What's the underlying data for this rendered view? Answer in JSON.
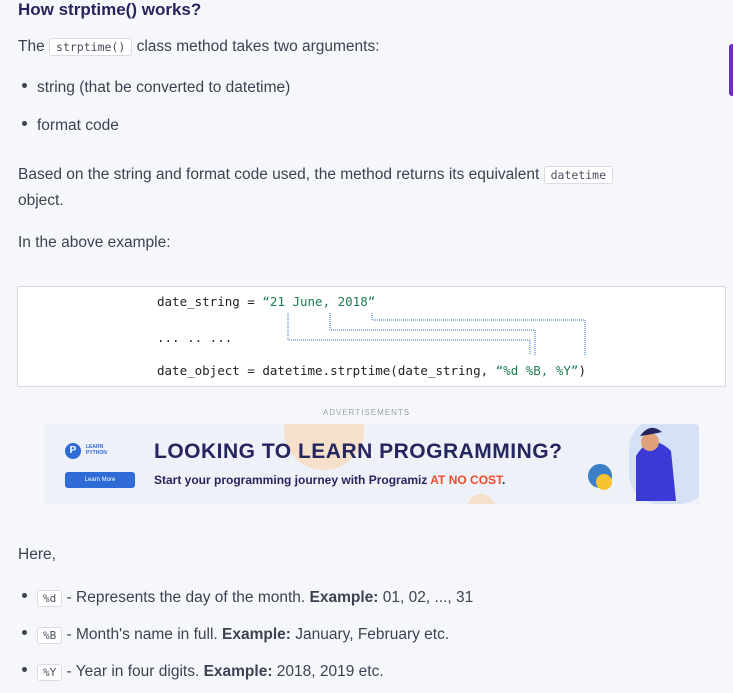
{
  "heading": "How strptime() works?",
  "intro": {
    "before": "The",
    "code": "strptime()",
    "after": "class method takes two arguments:"
  },
  "args": [
    "string (that be converted to datetime)",
    "format code"
  ],
  "returns": {
    "before": "Based on the string and format code used, the method returns its equivalent",
    "code": "datetime",
    "after": "object."
  },
  "example_intro": "In the above example:",
  "code_example": {
    "line1_var": "date_string = ",
    "line1_str": "“21 June, 2018”",
    "line2": "... .. ...",
    "line3_code": "date_object = datetime.strptime(date_string, ",
    "line3_str": "“%d %B, %Y”",
    "line3_end": ")"
  },
  "ad": {
    "label": "ADVERTISEMENTS",
    "logo_line1": "LEARN",
    "logo_line2": "PYTHON",
    "button": "Learn More",
    "headline": "LOOKING TO LEARN PROGRAMMING?",
    "sub_before": "Start your programming journey with Programiz",
    "sub_highlight": "AT NO COST",
    "sub_after": "."
  },
  "here": "Here,",
  "directives": [
    {
      "code": "%d",
      "text": " - Represents the day of the month. ",
      "label": "Example:",
      "example": " 01, 02, ..., 31"
    },
    {
      "code": "%B",
      "text": " - Month's name in full. ",
      "label": "Example:",
      "example": " January, February etc."
    },
    {
      "code": "%Y",
      "text": " - Year in four digits. ",
      "label": "Example:",
      "example": " 2018, 2019 etc."
    }
  ],
  "colors": {
    "accent_purple": "#6f2dc2",
    "heading": "#25265e",
    "string_green": "#1b7d4f",
    "cost_red": "#f24a2c"
  }
}
